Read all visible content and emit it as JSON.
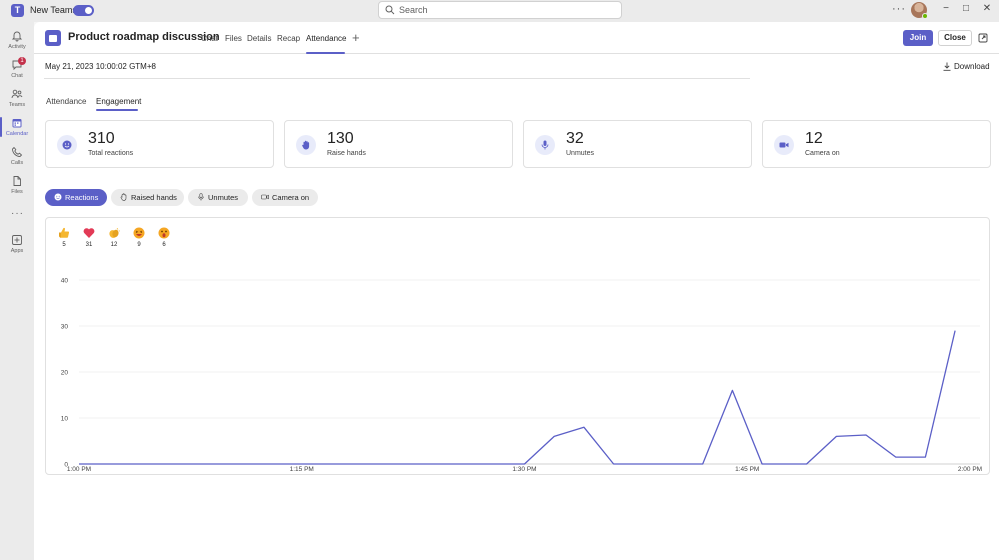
{
  "app": {
    "name": "New Teams",
    "search_placeholder": "Search",
    "more_label": "···"
  },
  "window": {
    "minimize": "−",
    "maximize": "□",
    "close": "✕"
  },
  "rail": {
    "items": [
      {
        "label": "Activity",
        "icon": "bell-icon"
      },
      {
        "label": "Chat",
        "icon": "chat-icon",
        "badge": "1"
      },
      {
        "label": "Teams",
        "icon": "teams-icon"
      },
      {
        "label": "Calendar",
        "icon": "calendar-icon",
        "active": true
      },
      {
        "label": "Calls",
        "icon": "phone-icon"
      },
      {
        "label": "Files",
        "icon": "file-icon"
      },
      {
        "label": "Apps",
        "icon": "apps-icon"
      }
    ],
    "more": "···"
  },
  "meeting": {
    "title": "Product roadmap discussion",
    "tabs": [
      "Chat",
      "Files",
      "Details",
      "Recap",
      "Attendance"
    ],
    "active_tab": "Attendance",
    "add_tab": "+",
    "join_label": "Join",
    "close_label": "Close"
  },
  "report": {
    "date": "May 21, 2023 10:00:02 GTM+8",
    "download_label": "Download",
    "subtabs": [
      "Attendance",
      "Engagement"
    ],
    "active_subtab": "Engagement"
  },
  "stats": [
    {
      "value": "310",
      "label": "Total reactions",
      "icon": "smiley-icon"
    },
    {
      "value": "130",
      "label": "Raise hands",
      "icon": "hand-icon"
    },
    {
      "value": "32",
      "label": "Unmutes",
      "icon": "microphone-icon"
    },
    {
      "value": "12",
      "label": "Camera on",
      "icon": "video-camera-icon"
    }
  ],
  "filters": [
    {
      "label": "Reactions",
      "icon": "smiley-icon",
      "active": true
    },
    {
      "label": "Raised hands",
      "icon": "hand-icon"
    },
    {
      "label": "Unmutes",
      "icon": "microphone-icon"
    },
    {
      "label": "Camera on",
      "icon": "video-camera-icon"
    }
  ],
  "reactions": [
    {
      "name": "like",
      "icon": "thumbs-up-icon",
      "count": "5",
      "color": "#f5b731"
    },
    {
      "name": "heart",
      "icon": "heart-icon",
      "count": "31",
      "color": "#e23a56"
    },
    {
      "name": "applause",
      "icon": "clapping-hands-icon",
      "count": "12",
      "color": "#f5b731"
    },
    {
      "name": "laugh",
      "icon": "laughing-face-icon",
      "count": "9",
      "color": "#f5a623"
    },
    {
      "name": "surprised",
      "icon": "surprised-face-icon",
      "count": "6",
      "color": "#f5a623"
    }
  ],
  "colors": {
    "accent": "#5b5fc7",
    "line": "#5b5fc7"
  },
  "chart_data": {
    "type": "line",
    "series": [
      {
        "x": [
          "1:00 PM",
          "1:04 PM",
          "1:08 PM",
          "1:12 PM",
          "1:16 PM",
          "1:20 PM",
          "1:24 PM",
          "1:28 PM",
          "1:32 PM",
          "1:36 PM",
          "1:40 PM",
          "1:44 PM",
          "1:48 PM",
          "1:52 PM",
          "1:56 PM",
          "1:58 PM",
          "2:00 PM"
        ],
        "values": [
          0,
          0,
          0,
          0,
          0,
          0,
          0,
          0,
          6,
          8,
          0,
          0,
          16,
          0,
          0,
          5,
          29
        ]
      }
    ],
    "x_ticks": [
      "1:00 PM",
      "1:15 PM",
      "1:30 PM",
      "1:45 PM",
      "2:00 PM"
    ],
    "y_ticks": [
      "40",
      "30",
      "20",
      "10",
      "0"
    ],
    "ylim": [
      0,
      40
    ],
    "points": [
      {
        "t": 0,
        "v": 0
      },
      {
        "t": 30,
        "v": 0
      },
      {
        "t": 32,
        "v": 6
      },
      {
        "t": 34,
        "v": 8
      },
      {
        "t": 36,
        "v": 0
      },
      {
        "t": 42,
        "v": 0
      },
      {
        "t": 44,
        "v": 16
      },
      {
        "t": 46,
        "v": 0
      },
      {
        "t": 49,
        "v": 0
      },
      {
        "t": 51,
        "v": 6
      },
      {
        "t": 53,
        "v": 6.3
      },
      {
        "t": 55,
        "v": 1.5
      },
      {
        "t": 57,
        "v": 1.5
      },
      {
        "t": 59,
        "v": 29
      }
    ],
    "grid": true
  }
}
